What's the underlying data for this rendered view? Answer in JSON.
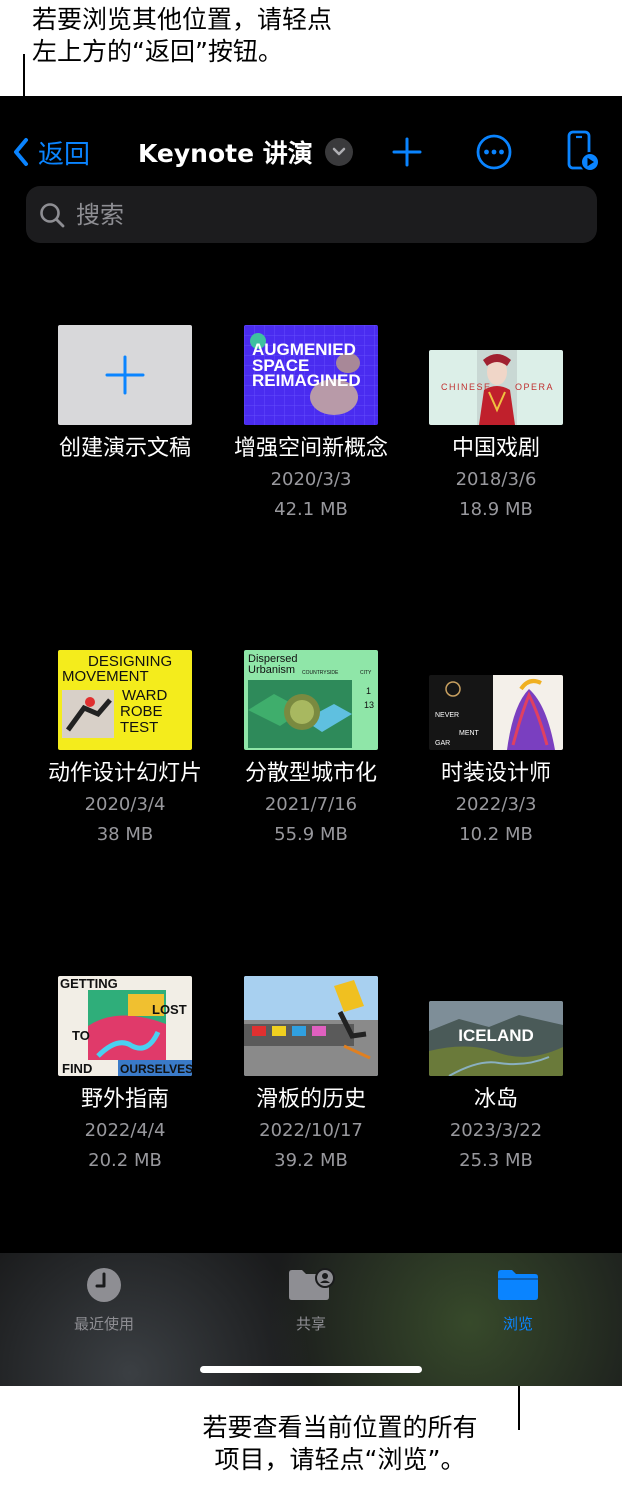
{
  "callouts": {
    "top_line1": "若要浏览其他位置，请轻点",
    "top_line2": "左上方的“返回”按钮。",
    "bottom_line1": "若要查看当前位置的所有",
    "bottom_line2": "项目，请轻点“浏览”。"
  },
  "navbar": {
    "back_label": "返回",
    "title": "Keynote 讲演",
    "back_icon": "chevron-left-icon",
    "title_menu_icon": "chevron-down-icon",
    "add_icon": "plus-icon",
    "more_icon": "ellipsis-circle-icon",
    "remote_icon": "phone-play-icon"
  },
  "search": {
    "placeholder": "搜索",
    "value": "",
    "icon": "magnifying-glass-icon"
  },
  "files": [
    {
      "name": "创建演示文稿",
      "date": "",
      "size": "",
      "kind": "create"
    },
    {
      "name": "增强空间新概念",
      "date": "2020/3/3",
      "size": "42.1 MB",
      "thumb_text": [
        "AUGMENIED",
        "SPACE",
        "REIMAGINED"
      ]
    },
    {
      "name": "中国戏剧",
      "date": "2018/3/6",
      "size": "18.9 MB",
      "thumb_text": [
        "CHINESE",
        "OPERA"
      ]
    },
    {
      "name": "动作设计幻灯片",
      "date": "2020/3/4",
      "size": "38 MB",
      "thumb_text": [
        "DESIGNING",
        "MOVEMENT",
        "WARD",
        "ROBE",
        "TEST"
      ]
    },
    {
      "name": "分散型城市化",
      "date": "2021/7/16",
      "size": "55.9 MB",
      "thumb_text": [
        "Dispersed",
        "Urbanism",
        "COUNTRYSIDE",
        "CITY",
        "1",
        "13"
      ]
    },
    {
      "name": "时装设计师",
      "date": "2022/3/3",
      "size": "10.2 MB",
      "thumb_text": [
        "NEVER",
        "MENT",
        "GAR"
      ]
    },
    {
      "name": "野外指南",
      "date": "2022/4/4",
      "size": "20.2 MB",
      "thumb_text": [
        "GETTING",
        "LOST",
        "TO",
        "FIND",
        "OURSELVES"
      ]
    },
    {
      "name": "滑板的历史",
      "date": "2022/10/17",
      "size": "39.2 MB",
      "thumb_text": []
    },
    {
      "name": "冰岛",
      "date": "2023/3/22",
      "size": "25.3 MB",
      "thumb_text": [
        "ICELAND"
      ]
    }
  ],
  "tabs": [
    {
      "label": "最近使用",
      "icon": "clock-icon",
      "selected": false
    },
    {
      "label": "共享",
      "icon": "shared-folder-icon",
      "selected": false
    },
    {
      "label": "浏览",
      "icon": "folder-icon",
      "selected": true
    }
  ],
  "colors": {
    "accent": "#0a84ff",
    "background": "#000000",
    "secondary_text": "#98989d"
  }
}
